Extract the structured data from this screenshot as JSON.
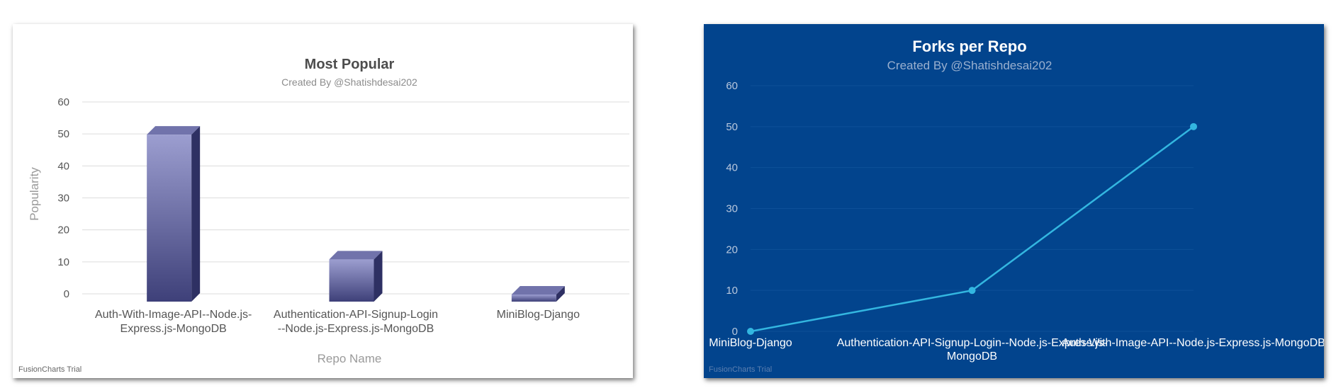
{
  "chart_data": [
    {
      "type": "bar",
      "title": "Most Popular",
      "subtitle": "Created By @Shatishdesai202",
      "xlabel": "Repo Name",
      "ylabel": "Popularity",
      "categories": [
        [
          "Auth-With-Image-API--Node.js-",
          "Express.js-MongoDB"
        ],
        [
          "Authentication-API-Signup-Login",
          "--Node.js-Express.js-MongoDB"
        ],
        [
          "MiniBlog-Django"
        ]
      ],
      "values": [
        50,
        11,
        0
      ],
      "ylim": [
        0,
        60
      ],
      "yticks": [
        0,
        10,
        20,
        30,
        40,
        50,
        60
      ],
      "grid": true,
      "legend": "none",
      "colors": {
        "bar_front_top": "#9c9ed0",
        "bar_front_bottom": "#3e4079",
        "bar_side": "#2e3063",
        "bar_top": "#7173ab",
        "grid": "#dcdcdc"
      },
      "watermark": "FusionCharts Trial"
    },
    {
      "type": "line",
      "title": "Forks per Repo",
      "subtitle": "Created By @Shatishdesai202",
      "xlabel": "",
      "ylabel": "",
      "categories": [
        [
          "MiniBlog-Django"
        ],
        [
          "Authentication-API-Signup-Login--Node.js-Express.js-",
          "MongoDB"
        ],
        [
          "Auth-With-Image-API--Node.js-Express.js-MongoDB"
        ]
      ],
      "values": [
        0,
        10,
        50
      ],
      "ylim": [
        0,
        60
      ],
      "yticks": [
        0,
        10,
        20,
        30,
        40,
        50,
        60
      ],
      "grid": true,
      "legend": "none",
      "colors": {
        "background": "#02448d",
        "line": "#33b6e0",
        "grid": "#0e4f98"
      },
      "watermark": "FusionCharts Trial"
    }
  ]
}
